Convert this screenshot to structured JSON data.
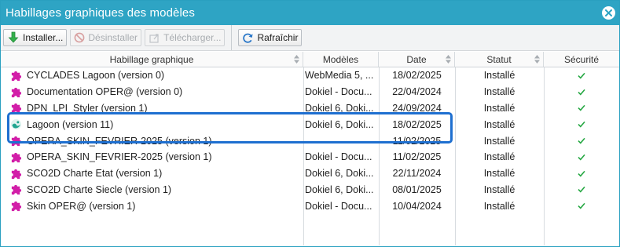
{
  "window": {
    "title": "Habillages graphiques des modèles"
  },
  "toolbar": {
    "install_label": "Installer...",
    "uninstall_label": "Désinstaller",
    "download_label": "Télécharger...",
    "refresh_label": "Rafraîchir"
  },
  "columns": {
    "name": "Habillage graphique",
    "models": "Modèles",
    "date": "Date",
    "status": "Statut",
    "security": "Sécurité"
  },
  "rows": [
    {
      "name": "CYCLADES Lagoon (version 0)",
      "models": "WebMedia 5, ...",
      "date": "18/02/2025",
      "status": "Installé",
      "icon": "puzzle-icon"
    },
    {
      "name": "Documentation OPER@ (version 0)",
      "models": "Dokiel - Docu...",
      "date": "22/04/2024",
      "status": "Installé",
      "icon": "puzzle-icon"
    },
    {
      "name": "DPN_LPI_Styler (version 1)",
      "models": "Dokiel 6, Doki...",
      "date": "24/09/2024",
      "status": "Installé",
      "icon": "puzzle-icon"
    },
    {
      "name": "Lagoon (version 11)",
      "models": "Dokiel 6, Doki...",
      "date": "18/02/2025",
      "status": "Installé",
      "icon": "lagoon-wave-icon"
    },
    {
      "name": "OPERA_SKIN_FEVRIER-2025 (version 1)",
      "models": "",
      "date": "11/02/2025",
      "status": "Installé",
      "icon": "puzzle-icon"
    },
    {
      "name": "OPERA_SKIN_FEVRIER-2025 (version 1)",
      "models": "Dokiel - Docu...",
      "date": "11/02/2025",
      "status": "Installé",
      "icon": "puzzle-icon"
    },
    {
      "name": "SCO2D Charte Etat (version 1)",
      "models": "Dokiel 6, Doki...",
      "date": "22/11/2024",
      "status": "Installé",
      "icon": "puzzle-icon"
    },
    {
      "name": "SCO2D Charte Siecle (version 1)",
      "models": "Dokiel 6, Doki...",
      "date": "08/01/2025",
      "status": "Installé",
      "icon": "puzzle-icon"
    },
    {
      "name": "Skin OPER@ (version 1)",
      "models": "Dokiel - Docu...",
      "date": "10/04/2024",
      "status": "Installé",
      "icon": "puzzle-icon"
    }
  ],
  "colors": {
    "titlebar": "#2ea4c4",
    "puzzle": "#d21ea8",
    "check": "#27a844",
    "highlight": "#1e6fd0"
  }
}
